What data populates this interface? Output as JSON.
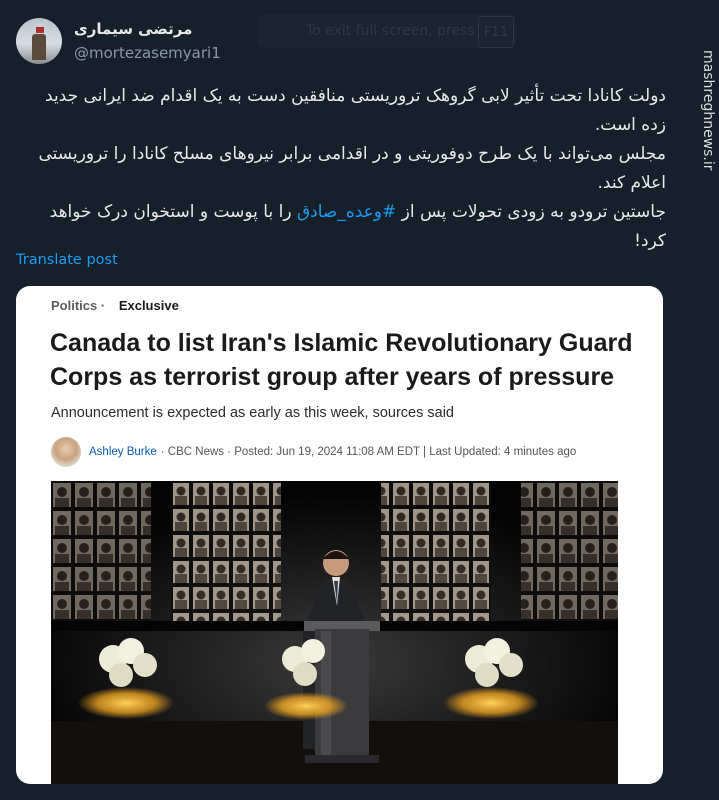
{
  "tweet": {
    "display_name": "مرتضی سیماری",
    "handle": "@mortezasemyari1",
    "text_line1": "دولت کانادا تحت تأثیر لابی گروهک تروریستی منافقین دست به یک اقدام ضد ایرانی جدید زده است.",
    "text_line2": "مجلس می‌تواند با یک طرح دوفوریتی و در اقدامی برابر نیروهای مسلح کانادا را تروریستی اعلام کند.",
    "text_line3_before": "جاستین ترودو به زودی تحولات پس از",
    "hashtag": "#وعده_صادق",
    "text_line3_after": "را با پوست و استخوان درک خواهد کرد!",
    "translate_label": "Translate post"
  },
  "overlay": {
    "fullscreen_notice": "To exit full screen, press",
    "fullscreen_key": "F11"
  },
  "card": {
    "section": "Politics",
    "label": "Exclusive",
    "headline": "Canada to list Iran's Islamic Revolutionary Guard Corps as terrorist group after years of pressure",
    "deck": "Announcement is expected as early as this week, sources said",
    "author": "Ashley Burke",
    "byline_rest": "· CBC News · Posted: Jun 19, 2024 11:08 AM EDT | Last Updated: 4 minutes ago"
  },
  "watermark": "mashreghnews.ir",
  "colors": {
    "background": "#15202b",
    "link": "#1d9bf0",
    "text": "#e7e9ea",
    "muted": "#8b98a5"
  }
}
